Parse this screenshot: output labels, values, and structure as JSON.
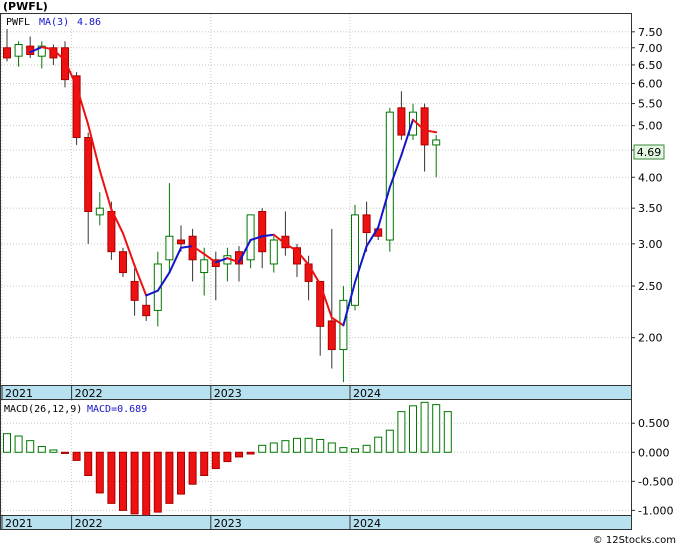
{
  "ticker_title": "(PWFL)",
  "watermark": "© 12Stocks.com",
  "colors": {
    "up_fill": "#ffffff",
    "up_stroke": "#007700",
    "down_fill": "#ee1111",
    "ma_up": "#1515cc",
    "ma_down": "#ee1111",
    "grid": "#c8c8c8",
    "axis_band": "#b7e1ee",
    "price_tag_bg": "#e3f7e3",
    "price_tag_border": "#3a8a3a"
  },
  "chart_data": [
    {
      "type": "candlestick",
      "legend": {
        "symbol": "PWFL",
        "ma_label": "MA(3)",
        "ma_value": "4.86"
      },
      "last_price_tag": "4.69",
      "y_scale": "log",
      "ylim": [
        1.63,
        8.1
      ],
      "y_ticks": [
        "7.50",
        "7.00",
        "6.50",
        "6.00",
        "5.50",
        "5.00",
        "4.50",
        "4.00",
        "3.50",
        "3.00",
        "2.50",
        "2.00"
      ],
      "x_labels": [
        "2021",
        "2022",
        "2023",
        "2024"
      ],
      "x_label_index": [
        0,
        6,
        18,
        30
      ],
      "grid": true,
      "candles": [
        {
          "o": 7.0,
          "h": 7.6,
          "l": 6.6,
          "c": 6.7
        },
        {
          "o": 6.75,
          "h": 7.2,
          "l": 6.45,
          "c": 7.1
        },
        {
          "o": 7.05,
          "h": 7.35,
          "l": 6.7,
          "c": 6.8
        },
        {
          "o": 6.75,
          "h": 7.2,
          "l": 6.4,
          "c": 7.05
        },
        {
          "o": 7.0,
          "h": 7.1,
          "l": 6.5,
          "c": 6.7
        },
        {
          "o": 7.0,
          "h": 7.2,
          "l": 5.9,
          "c": 6.1
        },
        {
          "o": 6.2,
          "h": 6.3,
          "l": 4.6,
          "c": 4.75
        },
        {
          "o": 4.75,
          "h": 4.85,
          "l": 3.0,
          "c": 3.45
        },
        {
          "o": 3.4,
          "h": 3.75,
          "l": 3.25,
          "c": 3.5
        },
        {
          "o": 3.45,
          "h": 3.6,
          "l": 2.8,
          "c": 2.9
        },
        {
          "o": 2.9,
          "h": 2.95,
          "l": 2.6,
          "c": 2.65
        },
        {
          "o": 2.55,
          "h": 2.7,
          "l": 2.2,
          "c": 2.35
        },
        {
          "o": 2.3,
          "h": 2.4,
          "l": 2.15,
          "c": 2.2
        },
        {
          "o": 2.25,
          "h": 2.9,
          "l": 2.1,
          "c": 2.75
        },
        {
          "o": 2.8,
          "h": 3.9,
          "l": 2.65,
          "c": 3.1
        },
        {
          "o": 3.05,
          "h": 3.25,
          "l": 2.9,
          "c": 3.0
        },
        {
          "o": 3.1,
          "h": 3.2,
          "l": 2.55,
          "c": 2.8
        },
        {
          "o": 2.65,
          "h": 2.95,
          "l": 2.4,
          "c": 2.8
        },
        {
          "o": 2.8,
          "h": 2.9,
          "l": 2.35,
          "c": 2.72
        },
        {
          "o": 2.75,
          "h": 2.95,
          "l": 2.55,
          "c": 2.85
        },
        {
          "o": 2.9,
          "h": 2.97,
          "l": 2.55,
          "c": 2.75
        },
        {
          "o": 2.8,
          "h": 3.35,
          "l": 2.7,
          "c": 3.4
        },
        {
          "o": 3.45,
          "h": 3.5,
          "l": 2.7,
          "c": 2.9
        },
        {
          "o": 2.75,
          "h": 3.1,
          "l": 2.65,
          "c": 3.05
        },
        {
          "o": 3.1,
          "h": 3.45,
          "l": 2.85,
          "c": 2.95
        },
        {
          "o": 2.95,
          "h": 3.0,
          "l": 2.6,
          "c": 2.75
        },
        {
          "o": 2.75,
          "h": 2.85,
          "l": 2.35,
          "c": 2.55
        },
        {
          "o": 2.55,
          "h": 2.55,
          "l": 1.85,
          "c": 2.1
        },
        {
          "o": 2.15,
          "h": 3.2,
          "l": 1.75,
          "c": 1.9
        },
        {
          "o": 1.9,
          "h": 2.5,
          "l": 1.65,
          "c": 2.35
        },
        {
          "o": 2.3,
          "h": 3.55,
          "l": 2.25,
          "c": 3.4
        },
        {
          "o": 3.4,
          "h": 3.6,
          "l": 2.9,
          "c": 3.15
        },
        {
          "o": 3.2,
          "h": 3.25,
          "l": 3.05,
          "c": 3.1
        },
        {
          "o": 3.05,
          "h": 5.4,
          "l": 2.9,
          "c": 5.3
        },
        {
          "o": 5.4,
          "h": 5.8,
          "l": 4.7,
          "c": 4.8
        },
        {
          "o": 4.8,
          "h": 5.5,
          "l": 4.7,
          "c": 5.3
        },
        {
          "o": 5.4,
          "h": 5.5,
          "l": 4.1,
          "c": 4.6
        },
        {
          "o": 4.6,
          "h": 4.8,
          "l": 4.0,
          "c": 4.7
        }
      ],
      "ma": [
        null,
        null,
        6.87,
        7.02,
        6.95,
        6.62,
        5.92,
        5.02,
        4.12,
        3.48,
        3.14,
        2.73,
        2.4,
        2.45,
        2.65,
        2.95,
        2.97,
        2.87,
        2.77,
        2.82,
        2.77,
        3.05,
        3.1,
        3.12,
        3.0,
        2.91,
        2.74,
        2.52,
        2.18,
        2.11,
        2.54,
        2.97,
        3.22,
        3.83,
        4.4,
        5.13,
        4.9,
        4.86
      ]
    },
    {
      "type": "bar",
      "legend": {
        "name": "MACD(26,12,9)",
        "value_label": "MACD=0.689"
      },
      "ylim": [
        -1.08,
        0.9
      ],
      "y_ticks": [
        "0.500",
        "0.000",
        "-0.500",
        "-1.000"
      ],
      "x_labels": [
        "2021",
        "2022",
        "2023",
        "2024"
      ],
      "values": [
        0.32,
        0.28,
        0.2,
        0.1,
        0.04,
        -0.02,
        -0.14,
        -0.4,
        -0.7,
        -0.88,
        -1.0,
        -1.06,
        -1.1,
        -1.03,
        -0.88,
        -0.72,
        -0.55,
        -0.4,
        -0.28,
        -0.16,
        -0.08,
        -0.03,
        0.12,
        0.16,
        0.2,
        0.24,
        0.24,
        0.22,
        0.16,
        0.08,
        0.06,
        0.12,
        0.26,
        0.38,
        0.7,
        0.8,
        0.86,
        0.82,
        0.7
      ]
    }
  ]
}
